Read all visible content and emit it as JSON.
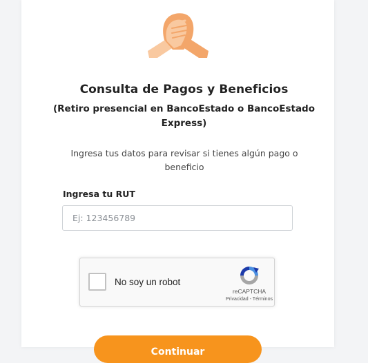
{
  "header": {
    "logo_icon": "handshake-icon",
    "title": "Consulta de Pagos y Beneficios",
    "subtitle": "(Retiro presencial en BancoEstado o BancoEstado Express)"
  },
  "form": {
    "intro": "Ingresa tus datos para revisar si tienes algún pago o beneficio",
    "rut_label": "Ingresa tu RUT",
    "rut_placeholder": "Ej: 123456789",
    "rut_value": ""
  },
  "recaptcha": {
    "label": "No soy un robot",
    "brand": "reCAPTCHA",
    "privacy": "Privacidad",
    "separator": " - ",
    "terms": "Términos",
    "logo_icon": "recaptcha-icon"
  },
  "actions": {
    "continue_label": "Continuar"
  },
  "colors": {
    "accent": "#f7941d",
    "skin_light": "#f9c9a0",
    "skin_dark": "#f3a66a"
  }
}
